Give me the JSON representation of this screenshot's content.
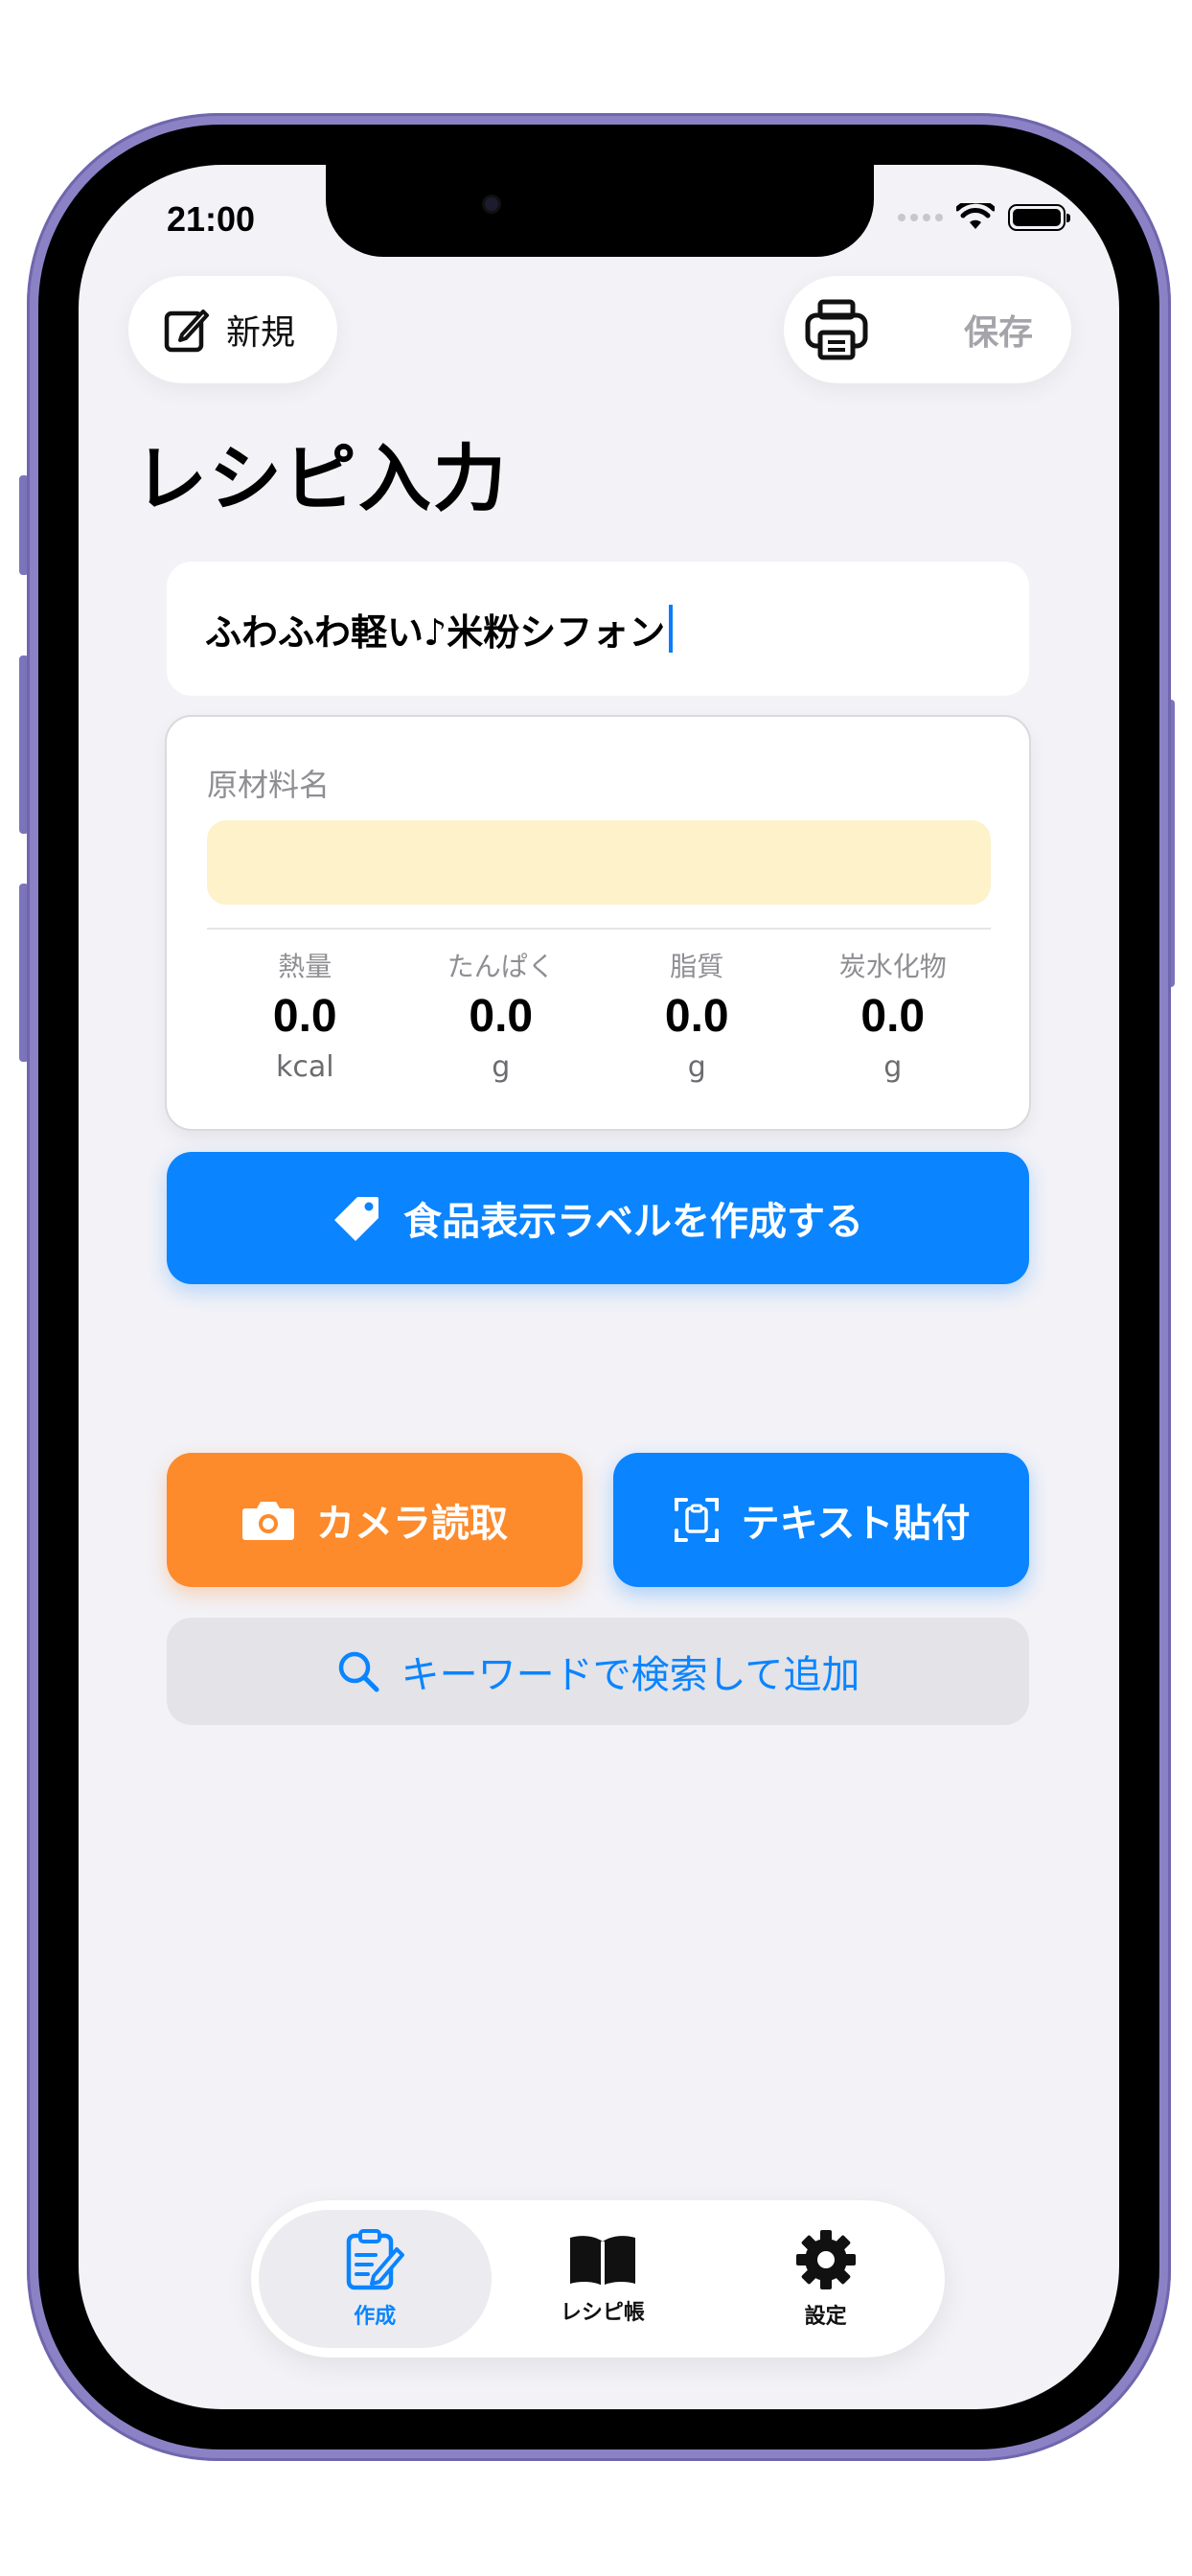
{
  "status_bar": {
    "time": "21:00"
  },
  "toolbar": {
    "new_label": "新規",
    "save_label": "保存"
  },
  "page_title": "レシピ入力",
  "recipe_name": {
    "value": "ふわふわ軽い♪米粉シフォン"
  },
  "ingredient_card": {
    "label": "原材料名",
    "input_value": "",
    "nutrition": [
      {
        "name": "熱量",
        "value": "0.0",
        "unit": "kcal"
      },
      {
        "name": "たんぱく",
        "value": "0.0",
        "unit": "g"
      },
      {
        "name": "脂質",
        "value": "0.0",
        "unit": "g"
      },
      {
        "name": "炭水化物",
        "value": "0.0",
        "unit": "g"
      }
    ]
  },
  "actions": {
    "create_label": "食品表示ラベルを作成する",
    "camera_scan": "カメラ読取",
    "paste_text": "テキスト貼付",
    "keyword_search": "キーワードで検索して追加"
  },
  "tabs": [
    {
      "label": "作成",
      "icon": "clipboard-edit-icon",
      "active": true
    },
    {
      "label": "レシピ帳",
      "icon": "book-icon",
      "active": false
    },
    {
      "label": "設定",
      "icon": "gear-icon",
      "active": false
    }
  ],
  "colors": {
    "accent_blue": "#0a84ff",
    "camera_orange": "#fd8a2b",
    "ingredient_input_bg": "#fdf2c9",
    "screen_bg": "#f2f2f7",
    "device_frame": "#8b82c6"
  }
}
